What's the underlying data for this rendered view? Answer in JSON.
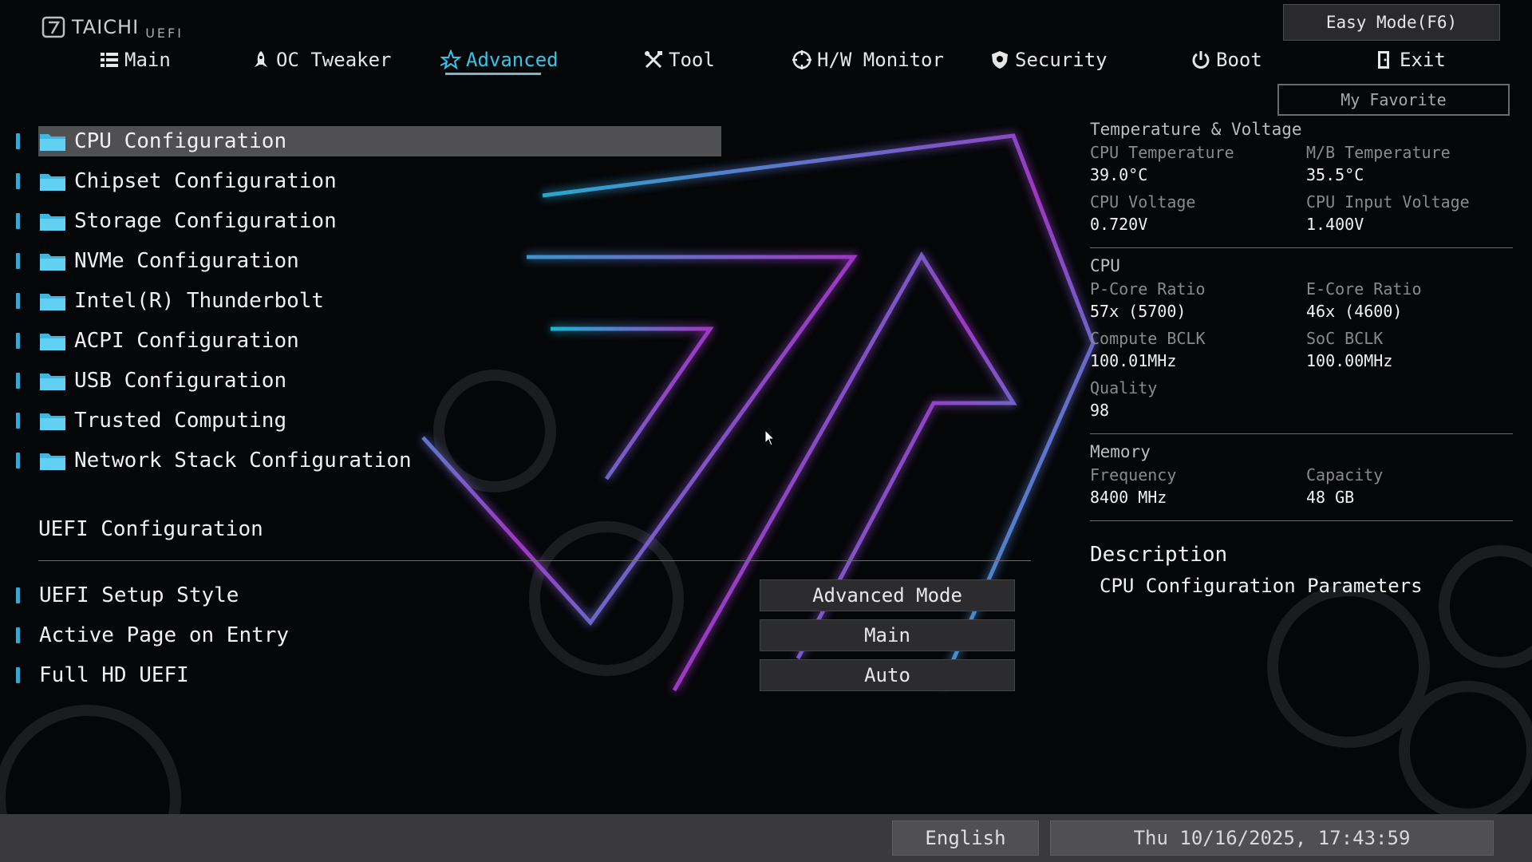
{
  "logo": {
    "brand": "TAICHI",
    "suffix": "UEFI"
  },
  "header": {
    "easy_mode_label": "Easy Mode(F6)",
    "my_favorite_label": "My Favorite"
  },
  "nav": {
    "tabs": [
      {
        "label": "Main",
        "icon": "list-icon"
      },
      {
        "label": "OC Tweaker",
        "icon": "rocket-icon"
      },
      {
        "label": "Advanced",
        "icon": "star-icon",
        "active": true
      },
      {
        "label": "Tool",
        "icon": "tools-icon"
      },
      {
        "label": "H/W Monitor",
        "icon": "monitor-icon"
      },
      {
        "label": "Security",
        "icon": "shield-icon"
      },
      {
        "label": "Boot",
        "icon": "power-icon"
      },
      {
        "label": "Exit",
        "icon": "exit-door-icon"
      }
    ]
  },
  "menu": {
    "items": [
      {
        "label": "CPU Configuration",
        "selected": true
      },
      {
        "label": "Chipset Configuration"
      },
      {
        "label": "Storage Configuration"
      },
      {
        "label": "NVMe Configuration"
      },
      {
        "label": "Intel(R) Thunderbolt"
      },
      {
        "label": "ACPI Configuration"
      },
      {
        "label": "USB Configuration"
      },
      {
        "label": "Trusted Computing"
      },
      {
        "label": "Network Stack Configuration"
      }
    ]
  },
  "uefi_section": {
    "title": "UEFI Configuration",
    "settings": [
      {
        "label": "UEFI Setup Style",
        "value": "Advanced Mode"
      },
      {
        "label": "Active Page on Entry",
        "value": "Main"
      },
      {
        "label": "Full HD UEFI",
        "value": "Auto"
      }
    ]
  },
  "panel": {
    "temp_voltage": {
      "title": "Temperature & Voltage",
      "cpu_temp_label": "CPU Temperature",
      "cpu_temp": "39.0°C",
      "mb_temp_label": "M/B Temperature",
      "mb_temp": "35.5°C",
      "cpu_volt_label": "CPU Voltage",
      "cpu_volt": "0.720V",
      "cpu_in_volt_label": "CPU Input Voltage",
      "cpu_in_volt": "1.400V"
    },
    "cpu": {
      "title": "CPU",
      "pcore_label": "P-Core Ratio",
      "pcore": "57x (5700)",
      "ecore_label": "E-Core Ratio",
      "ecore": "46x (4600)",
      "compute_bclk_label": "Compute BCLK",
      "compute_bclk": "100.01MHz",
      "soc_bclk_label": "SoC BCLK",
      "soc_bclk": "100.00MHz",
      "quality_label": "Quality",
      "quality": "98"
    },
    "memory": {
      "title": "Memory",
      "freq_label": "Frequency",
      "freq": "8400 MHz",
      "capacity_label": "Capacity",
      "capacity": "48 GB"
    }
  },
  "description": {
    "title": "Description",
    "text": "CPU Configuration Parameters"
  },
  "footer": {
    "language": "English",
    "datetime": "Thu 10/16/2025, 17:43:59"
  },
  "colors": {
    "accent": "#33c6e8",
    "bullet": "#3aa6cf",
    "selected_row": "#505052",
    "neon_cyan": "#1ec8e6",
    "neon_magenta": "#b03cd8"
  }
}
